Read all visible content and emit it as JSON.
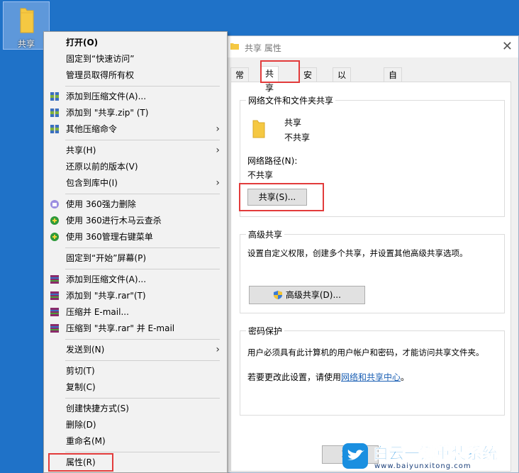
{
  "desktop": {
    "folder_label": "共享"
  },
  "menu": {
    "items": [
      {
        "label": "打开(O)",
        "bold": true,
        "icon": "",
        "arrow": false
      },
      {
        "label": "固定到“快速访问”",
        "icon": "",
        "arrow": false
      },
      {
        "label": "管理员取得所有权",
        "icon": "",
        "arrow": false
      },
      {
        "label": "添加到压缩文件(A)...",
        "icon": "winrar-icon",
        "arrow": false
      },
      {
        "label": "添加到 \"共享.zip\" (T)",
        "icon": "winrar-icon",
        "arrow": false
      },
      {
        "label": "其他压缩命令",
        "icon": "winrar-icon",
        "arrow": true
      },
      {
        "label": "共享(H)",
        "icon": "",
        "arrow": true
      },
      {
        "label": "还原以前的版本(V)",
        "icon": "",
        "arrow": false
      },
      {
        "label": "包含到库中(I)",
        "icon": "",
        "arrow": true
      },
      {
        "label": "使用 360强力删除",
        "icon": "360-delete-icon",
        "arrow": false
      },
      {
        "label": "使用 360进行木马云查杀",
        "icon": "360-scan-icon",
        "arrow": false
      },
      {
        "label": "使用 360管理右键菜单",
        "icon": "360-scan-icon",
        "arrow": false
      },
      {
        "label": "固定到“开始”屏幕(P)",
        "icon": "",
        "arrow": false
      },
      {
        "label": "添加到压缩文件(A)...",
        "icon": "rar-icon",
        "arrow": false
      },
      {
        "label": "添加到 \"共享.rar\"(T)",
        "icon": "rar-icon",
        "arrow": false
      },
      {
        "label": "压缩并 E-mail...",
        "icon": "rar-icon",
        "arrow": false
      },
      {
        "label": "压缩到 \"共享.rar\" 并 E-mail",
        "icon": "rar-icon",
        "arrow": false
      },
      {
        "label": "发送到(N)",
        "icon": "",
        "arrow": true
      },
      {
        "label": "剪切(T)",
        "icon": "",
        "arrow": false
      },
      {
        "label": "复制(C)",
        "icon": "",
        "arrow": false
      },
      {
        "label": "创建快捷方式(S)",
        "icon": "",
        "arrow": false
      },
      {
        "label": "删除(D)",
        "icon": "",
        "arrow": false
      },
      {
        "label": "重命名(M)",
        "icon": "",
        "arrow": false
      },
      {
        "label": "属性(R)",
        "icon": "",
        "arrow": false
      }
    ]
  },
  "window": {
    "title": "共享 属性",
    "tabs": [
      "常规",
      "共享",
      "安全",
      "以前的版本",
      "自定义"
    ],
    "network_group": {
      "title": "网络文件和文件夹共享",
      "folder_name": "共享",
      "share_state": "不共享",
      "path_label": "网络路径(N):",
      "path_value": "不共享",
      "share_button": "共享(S)..."
    },
    "advanced_group": {
      "title": "高级共享",
      "description": "设置自定义权限，创建多个共享，并设置其他高级共享选项。",
      "button": "高级共享(D)..."
    },
    "password_group": {
      "title": "密码保护",
      "text1": "用户必须具有此计算机的用户帐户和密码，才能访问共享文件夹。",
      "text2_prefix": "若要更改此设置，请使用",
      "text2_link": "网络和共享中心",
      "text2_suffix": "。"
    },
    "bottom_button": "取消"
  },
  "watermark": {
    "brand": "白云一键重装系统",
    "url": "www.baiyunxitong.com"
  },
  "colors": {
    "desktop": "#1f72c8",
    "highlight_red": "#e23b3b",
    "link": "#1a5fb4",
    "folder": "#f5c842"
  }
}
